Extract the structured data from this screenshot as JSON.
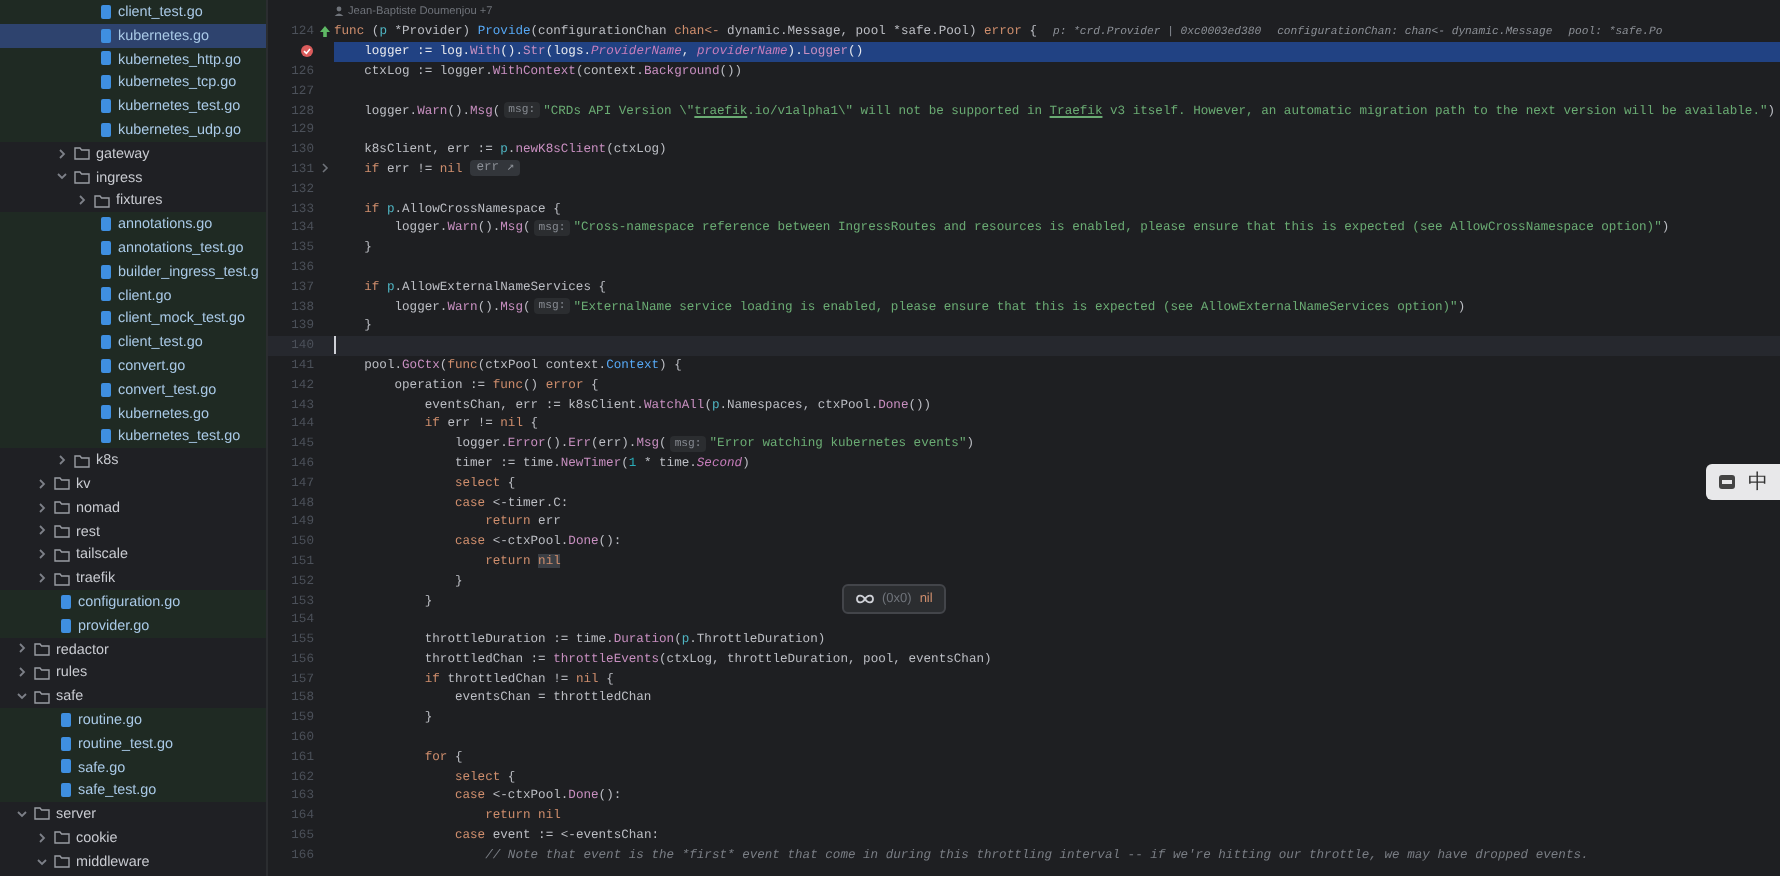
{
  "project_tree": [
    {
      "children": [
        {
          "children": [
            {
              "children": [
                {
                  "name": "client_test.go",
                  "kind": "file",
                  "selected": false
                },
                {
                  "name": "kubernetes.go",
                  "kind": "file",
                  "selected": true
                },
                {
                  "name": "kubernetes_http.go",
                  "kind": "file",
                  "selected": false
                },
                {
                  "name": "kubernetes_tcp.go",
                  "kind": "file",
                  "selected": false
                },
                {
                  "name": "kubernetes_test.go",
                  "kind": "file",
                  "selected": false
                },
                {
                  "name": "kubernetes_udp.go",
                  "kind": "file",
                  "selected": false
                }
              ]
            },
            {
              "name": "gateway",
              "kind": "folder",
              "expanded": false,
              "selected": false
            },
            {
              "name": "ingress",
              "kind": "folder",
              "expanded": true,
              "selected": false,
              "children": [
                {
                  "name": "fixtures",
                  "kind": "folder",
                  "expanded": false,
                  "selected": false
                },
                {
                  "name": "annotations.go",
                  "kind": "file",
                  "selected": false
                },
                {
                  "name": "annotations_test.go",
                  "kind": "file",
                  "selected": false
                },
                {
                  "name": "builder_ingress_test.g",
                  "kind": "file",
                  "selected": false
                },
                {
                  "name": "client.go",
                  "kind": "file",
                  "selected": false
                },
                {
                  "name": "client_mock_test.go",
                  "kind": "file",
                  "selected": false
                },
                {
                  "name": "client_test.go",
                  "kind": "file",
                  "selected": false
                },
                {
                  "name": "convert.go",
                  "kind": "file",
                  "selected": false
                },
                {
                  "name": "convert_test.go",
                  "kind": "file",
                  "selected": false
                },
                {
                  "name": "kubernetes.go",
                  "kind": "file",
                  "selected": false
                },
                {
                  "name": "kubernetes_test.go",
                  "kind": "file",
                  "selected": false
                }
              ]
            },
            {
              "name": "k8s",
              "kind": "folder",
              "expanded": false,
              "selected": false
            }
          ]
        },
        {
          "name": "kv",
          "kind": "folder",
          "expanded": false,
          "selected": false
        },
        {
          "name": "nomad",
          "kind": "folder",
          "expanded": false,
          "selected": false
        },
        {
          "name": "rest",
          "kind": "folder",
          "expanded": false,
          "selected": false
        },
        {
          "name": "tailscale",
          "kind": "folder",
          "expanded": false,
          "selected": false
        },
        {
          "name": "traefik",
          "kind": "folder",
          "expanded": false,
          "selected": false
        },
        {
          "name": "configuration.go",
          "kind": "file",
          "selected": false
        },
        {
          "name": "provider.go",
          "kind": "file",
          "selected": false
        }
      ]
    },
    {
      "name": "redactor",
      "kind": "folder",
      "expanded": false,
      "selected": false
    },
    {
      "name": "rules",
      "kind": "folder",
      "expanded": false,
      "selected": false
    },
    {
      "name": "safe",
      "kind": "folder",
      "expanded": true,
      "selected": false,
      "children": [
        {
          "name": "routine.go",
          "kind": "file",
          "selected": false
        },
        {
          "name": "routine_test.go",
          "kind": "file",
          "selected": false
        },
        {
          "name": "safe.go",
          "kind": "file",
          "selected": false
        },
        {
          "name": "safe_test.go",
          "kind": "file",
          "selected": false
        }
      ]
    },
    {
      "name": "server",
      "kind": "folder",
      "expanded": true,
      "selected": false,
      "children": [
        {
          "name": "cookie",
          "kind": "folder",
          "expanded": false,
          "selected": false
        },
        {
          "name": "middleware",
          "kind": "folder",
          "expanded": true,
          "selected": false
        }
      ]
    }
  ],
  "editor": {
    "blame": "Jean-Baptiste Doumenjou +7",
    "lines": [
      {
        "number": "124",
        "implements_marker": true,
        "segments": [
          {
            "kind": "kw",
            "t": "func"
          },
          {
            "kind": "plain",
            "t": " ("
          },
          {
            "kind": "param",
            "t": "p"
          },
          {
            "kind": "plain",
            "t": " *Provider) "
          },
          {
            "kind": "fn",
            "t": "Provide"
          },
          {
            "kind": "plain",
            "t": "(configurationChan "
          },
          {
            "kind": "kw",
            "t": "chan<-"
          },
          {
            "kind": "plain",
            "t": " dynamic.Message, pool *safe.Pool) "
          },
          {
            "kind": "kw",
            "t": "error"
          },
          {
            "kind": "plain",
            "t": " {"
          },
          {
            "kind": "debug",
            "t": "p: *crd.Provider | 0xc0003ed380"
          },
          {
            "kind": "debug",
            "t": "configurationChan: chan<- dynamic.Message"
          },
          {
            "kind": "debug",
            "t": "pool: *safe.Po"
          }
        ]
      },
      {
        "breakpoint": true,
        "execution_point": true,
        "segments": [
          {
            "kind": "plain",
            "t": "    logger := log."
          },
          {
            "kind": "call",
            "t": "With"
          },
          {
            "kind": "plain",
            "t": "()."
          },
          {
            "kind": "call",
            "t": "Str"
          },
          {
            "kind": "plain",
            "t": "(logs."
          },
          {
            "kind": "field",
            "t": "ProviderName"
          },
          {
            "kind": "plain",
            "t": ", "
          },
          {
            "kind": "field",
            "t": "providerName"
          },
          {
            "kind": "plain",
            "t": ")."
          },
          {
            "kind": "call",
            "t": "Logger"
          },
          {
            "kind": "plain",
            "t": "()"
          }
        ]
      },
      {
        "number": "126",
        "segments": [
          {
            "kind": "plain",
            "t": "    ctxLog := logger."
          },
          {
            "kind": "call",
            "t": "WithContext"
          },
          {
            "kind": "plain",
            "t": "(context."
          },
          {
            "kind": "call",
            "t": "Background"
          },
          {
            "kind": "plain",
            "t": "())"
          }
        ]
      },
      {
        "number": "127"
      },
      {
        "number": "128",
        "segments": [
          {
            "kind": "plain",
            "t": "    logger."
          },
          {
            "kind": "call",
            "t": "Warn"
          },
          {
            "kind": "plain",
            "t": "()."
          },
          {
            "kind": "call",
            "t": "Msg"
          },
          {
            "kind": "plain",
            "t": "("
          },
          {
            "kind": "hint",
            "t": "msg:"
          },
          {
            "kind": "str",
            "t": "\"CRDs API Version \\\""
          },
          {
            "kind": "link",
            "t": "traefik"
          },
          {
            "kind": "str",
            "t": ".io/v1alpha1\\\" will not be supported in "
          },
          {
            "kind": "link",
            "t": "Traefik"
          },
          {
            "kind": "str",
            "t": " v3 itself. However, an automatic migration path to the next version will be available.\""
          },
          {
            "kind": "plain",
            "t": ")"
          }
        ]
      },
      {
        "number": "129"
      },
      {
        "number": "130",
        "segments": [
          {
            "kind": "plain",
            "t": "    k8sClient, err := "
          },
          {
            "kind": "param",
            "t": "p"
          },
          {
            "kind": "plain",
            "t": "."
          },
          {
            "kind": "call",
            "t": "newK8sClient"
          },
          {
            "kind": "plain",
            "t": "(ctxLog)"
          }
        ]
      },
      {
        "number": "131",
        "foldable": true,
        "segments": [
          {
            "kind": "kw",
            "t": "    if"
          },
          {
            "kind": "plain",
            "t": " err != "
          },
          {
            "kind": "kw",
            "t": "nil"
          },
          {
            "kind": "folded",
            "t": "err ↗"
          }
        ]
      },
      {
        "number": "132"
      },
      {
        "number": "133",
        "segments": [
          {
            "kind": "kw",
            "t": "    if "
          },
          {
            "kind": "param",
            "t": "p"
          },
          {
            "kind": "plain",
            "t": ".AllowCrossNamespace {"
          }
        ]
      },
      {
        "number": "134",
        "segments": [
          {
            "kind": "plain",
            "t": "        logger."
          },
          {
            "kind": "call",
            "t": "Warn"
          },
          {
            "kind": "plain",
            "t": "()."
          },
          {
            "kind": "call",
            "t": "Msg"
          },
          {
            "kind": "plain",
            "t": "("
          },
          {
            "kind": "hint",
            "t": "msg:"
          },
          {
            "kind": "str",
            "t": "\"Cross-namespace reference between IngressRoutes and resources is enabled, please ensure that this is expected (see AllowCrossNamespace option)\""
          },
          {
            "kind": "plain",
            "t": ")"
          }
        ]
      },
      {
        "number": "135",
        "segments": [
          {
            "kind": "plain",
            "t": "    }"
          }
        ]
      },
      {
        "number": "136"
      },
      {
        "number": "137",
        "segments": [
          {
            "kind": "kw",
            "t": "    if "
          },
          {
            "kind": "param",
            "t": "p"
          },
          {
            "kind": "plain",
            "t": ".AllowExternalNameServices {"
          }
        ]
      },
      {
        "number": "138",
        "segments": [
          {
            "kind": "plain",
            "t": "        logger."
          },
          {
            "kind": "call",
            "t": "Warn"
          },
          {
            "kind": "plain",
            "t": "()."
          },
          {
            "kind": "call",
            "t": "Msg"
          },
          {
            "kind": "plain",
            "t": "("
          },
          {
            "kind": "hint",
            "t": "msg:"
          },
          {
            "kind": "str",
            "t": "\"ExternalName service loading is enabled, please ensure that this is expected (see AllowExternalNameServices option)\""
          },
          {
            "kind": "plain",
            "t": ")"
          }
        ]
      },
      {
        "number": "139",
        "segments": [
          {
            "kind": "plain",
            "t": "    }"
          }
        ]
      },
      {
        "number": "140",
        "caret": true
      },
      {
        "number": "141",
        "segments": [
          {
            "kind": "plain",
            "t": "    pool."
          },
          {
            "kind": "call",
            "t": "GoCtx"
          },
          {
            "kind": "plain",
            "t": "("
          },
          {
            "kind": "kw",
            "t": "func"
          },
          {
            "kind": "plain",
            "t": "(ctxPool context."
          },
          {
            "kind": "fn",
            "t": "Context"
          },
          {
            "kind": "plain",
            "t": ") {"
          }
        ]
      },
      {
        "number": "142",
        "segments": [
          {
            "kind": "plain",
            "t": "        operation := "
          },
          {
            "kind": "kw",
            "t": "func"
          },
          {
            "kind": "plain",
            "t": "() "
          },
          {
            "kind": "kw",
            "t": "error"
          },
          {
            "kind": "plain",
            "t": " {"
          }
        ]
      },
      {
        "number": "143",
        "segments": [
          {
            "kind": "plain",
            "t": "            eventsChan, err := k8sClient."
          },
          {
            "kind": "call",
            "t": "WatchAll"
          },
          {
            "kind": "plain",
            "t": "("
          },
          {
            "kind": "param",
            "t": "p"
          },
          {
            "kind": "plain",
            "t": ".Namespaces, ctxPool."
          },
          {
            "kind": "call",
            "t": "Done"
          },
          {
            "kind": "plain",
            "t": "())"
          }
        ]
      },
      {
        "number": "144",
        "segments": [
          {
            "kind": "kw",
            "t": "            if"
          },
          {
            "kind": "plain",
            "t": " err != "
          },
          {
            "kind": "kw",
            "t": "nil"
          },
          {
            "kind": "plain",
            "t": " {"
          }
        ]
      },
      {
        "number": "145",
        "segments": [
          {
            "kind": "plain",
            "t": "                logger."
          },
          {
            "kind": "call",
            "t": "Error"
          },
          {
            "kind": "plain",
            "t": "()."
          },
          {
            "kind": "call",
            "t": "Err"
          },
          {
            "kind": "plain",
            "t": "(err)."
          },
          {
            "kind": "call",
            "t": "Msg"
          },
          {
            "kind": "plain",
            "t": "("
          },
          {
            "kind": "hint",
            "t": "msg:"
          },
          {
            "kind": "str",
            "t": "\"Error watching kubernetes events\""
          },
          {
            "kind": "plain",
            "t": ")"
          }
        ]
      },
      {
        "number": "146",
        "segments": [
          {
            "kind": "plain",
            "t": "                timer := time."
          },
          {
            "kind": "call",
            "t": "NewTimer"
          },
          {
            "kind": "plain",
            "t": "("
          },
          {
            "kind": "num",
            "t": "1"
          },
          {
            "kind": "plain",
            "t": " * time."
          },
          {
            "kind": "field",
            "t": "Second"
          },
          {
            "kind": "plain",
            "t": ")"
          }
        ]
      },
      {
        "number": "147",
        "segments": [
          {
            "kind": "kw",
            "t": "                select"
          },
          {
            "kind": "plain",
            "t": " {"
          }
        ]
      },
      {
        "number": "148",
        "segments": [
          {
            "kind": "kw",
            "t": "                case"
          },
          {
            "kind": "plain",
            "t": " <-timer.C:"
          }
        ]
      },
      {
        "number": "149",
        "segments": [
          {
            "kind": "kw",
            "t": "                    return"
          },
          {
            "kind": "plain",
            "t": " err"
          }
        ]
      },
      {
        "number": "150",
        "segments": [
          {
            "kind": "kw",
            "t": "                case"
          },
          {
            "kind": "plain",
            "t": " <-ctxPool."
          },
          {
            "kind": "call",
            "t": "Done"
          },
          {
            "kind": "plain",
            "t": "():"
          }
        ]
      },
      {
        "number": "151",
        "segments": [
          {
            "kind": "kw",
            "t": "                    return "
          },
          {
            "kind": "match",
            "t": "nil"
          }
        ]
      },
      {
        "number": "152",
        "segments": [
          {
            "kind": "plain",
            "t": "                }"
          }
        ]
      },
      {
        "number": "153",
        "segments": [
          {
            "kind": "plain",
            "t": "            }"
          }
        ]
      },
      {
        "number": "154"
      },
      {
        "number": "155",
        "segments": [
          {
            "kind": "plain",
            "t": "            throttleDuration := time."
          },
          {
            "kind": "call",
            "t": "Duration"
          },
          {
            "kind": "plain",
            "t": "("
          },
          {
            "kind": "param",
            "t": "p"
          },
          {
            "kind": "plain",
            "t": ".ThrottleDuration)"
          }
        ]
      },
      {
        "number": "156",
        "segments": [
          {
            "kind": "plain",
            "t": "            throttledChan := "
          },
          {
            "kind": "call",
            "t": "throttleEvents"
          },
          {
            "kind": "plain",
            "t": "(ctxLog, throttleDuration, pool, eventsChan)"
          }
        ]
      },
      {
        "number": "157",
        "segments": [
          {
            "kind": "kw",
            "t": "            if"
          },
          {
            "kind": "plain",
            "t": " throttledChan != "
          },
          {
            "kind": "kw",
            "t": "nil"
          },
          {
            "kind": "plain",
            "t": " {"
          }
        ]
      },
      {
        "number": "158",
        "segments": [
          {
            "kind": "plain",
            "t": "                eventsChan = throttledChan"
          }
        ]
      },
      {
        "number": "159",
        "segments": [
          {
            "kind": "plain",
            "t": "            }"
          }
        ]
      },
      {
        "number": "160"
      },
      {
        "number": "161",
        "segments": [
          {
            "kind": "kw",
            "t": "            for"
          },
          {
            "kind": "plain",
            "t": " {"
          }
        ]
      },
      {
        "number": "162",
        "segments": [
          {
            "kind": "kw",
            "t": "                select"
          },
          {
            "kind": "plain",
            "t": " {"
          }
        ]
      },
      {
        "number": "163",
        "segments": [
          {
            "kind": "kw",
            "t": "                case"
          },
          {
            "kind": "plain",
            "t": " <-ctxPool."
          },
          {
            "kind": "call",
            "t": "Done"
          },
          {
            "kind": "plain",
            "t": "():"
          }
        ]
      },
      {
        "number": "164",
        "segments": [
          {
            "kind": "kw",
            "t": "                    return nil"
          }
        ]
      },
      {
        "number": "165",
        "segments": [
          {
            "kind": "kw",
            "t": "                case"
          },
          {
            "kind": "plain",
            "t": " event := <-eventsChan:"
          }
        ]
      },
      {
        "number": "166",
        "segments": [
          {
            "kind": "cmt",
            "t": "                    // Note that event is the *first* event that come in during this throttling interval -- if we're hitting our throttle, we may have dropped events."
          }
        ]
      }
    ]
  },
  "value_popup": {
    "address": "(0x0)",
    "value": "nil"
  },
  "ime_indicator": {
    "label": "中"
  }
}
